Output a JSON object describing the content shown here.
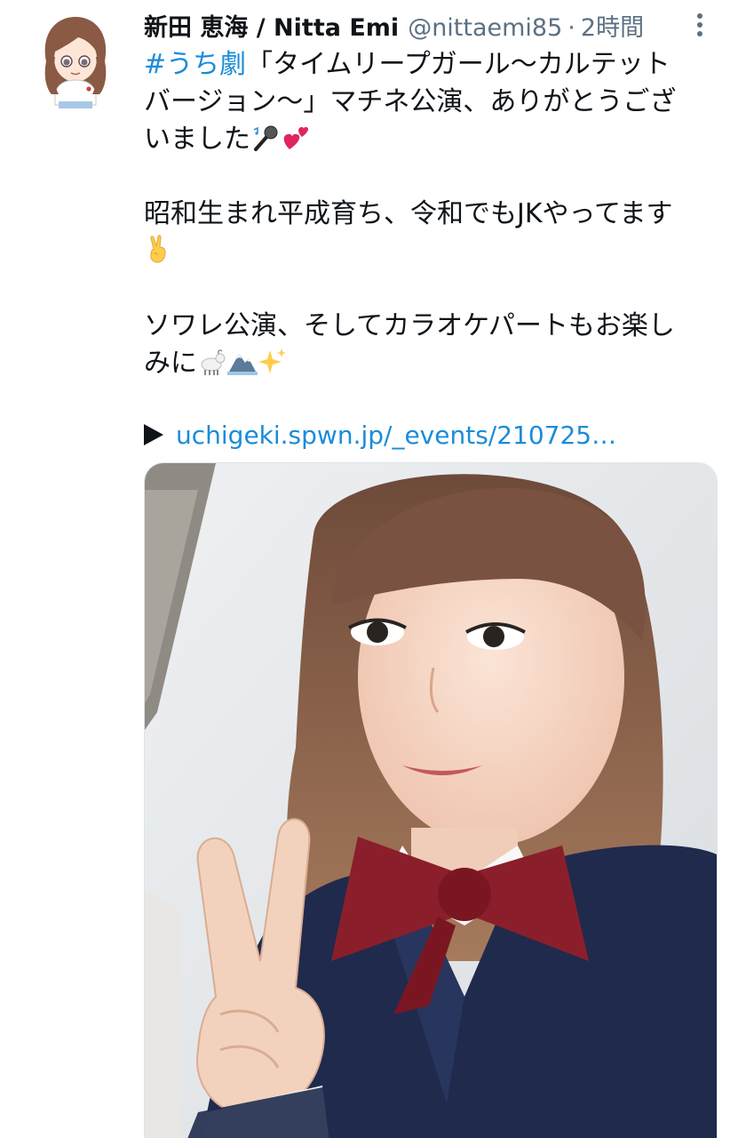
{
  "tweet": {
    "display_name": "新田 恵海 / Nitta Emi",
    "handle": "@nittaemi85",
    "separator": "·",
    "timestamp": "2時間",
    "hashtag": "#うち劇",
    "line1_rest": "「タイムリープガール～カルテット",
    "line2": "バージョン～」マチネ公演、ありがとうござ",
    "line3": "いました",
    "para2_line1": "昭和生まれ平成育ち、令和でもJKやってます",
    "para3_line1": "ソワレ公演、そしてカラオケパートもお楽し",
    "para3_line2": "みに",
    "link_text": "uchigeki.spwn.jp/_events/210725…",
    "emojis": [
      "microphone-emoji",
      "two-hearts-emoji",
      "victory-hand-emoji",
      "goat-emoji",
      "mountain-emoji",
      "sparkles-emoji"
    ]
  },
  "colors": {
    "link": "#1b8cd8",
    "secondary_text": "#5b7083",
    "primary_text": "#0f1419"
  }
}
